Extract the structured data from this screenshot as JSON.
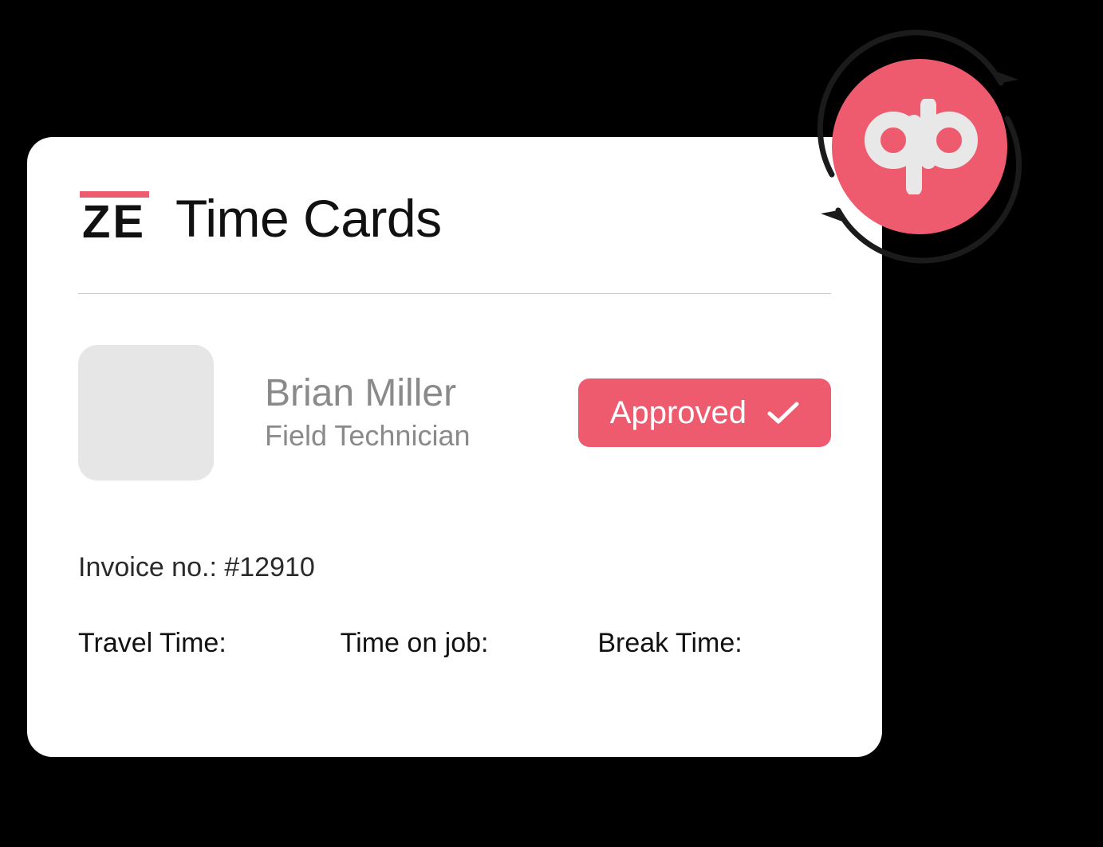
{
  "logo": {
    "text": "ZE"
  },
  "page_title": "Time Cards",
  "person": {
    "name": "Brian Miller",
    "role": "Field Technician"
  },
  "status": {
    "label": "Approved",
    "color": "#ef5b6e"
  },
  "invoice": {
    "label": "Invoice no.:",
    "number": "#12910"
  },
  "times": {
    "travel_label": "Travel Time:",
    "on_job_label": "Time on job:",
    "break_label": "Break Time:"
  },
  "sync": {
    "partner": "qb",
    "icon_name": "quickbooks-icon"
  }
}
